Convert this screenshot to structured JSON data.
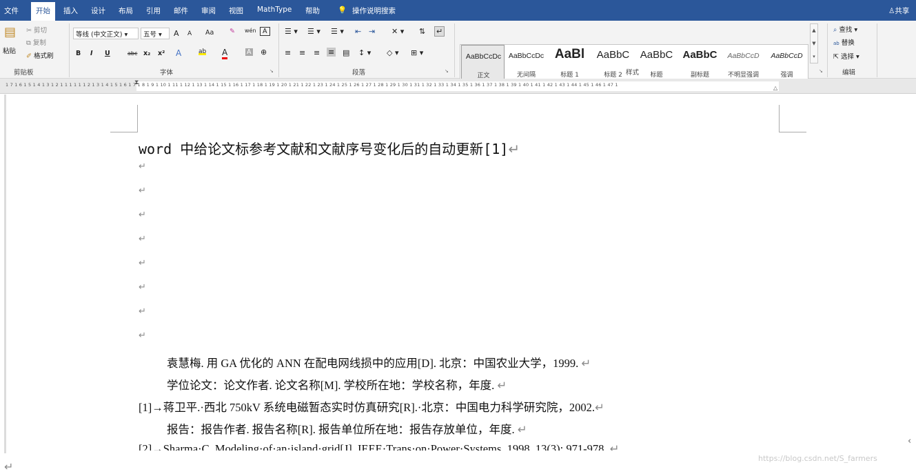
{
  "tabs": [
    "文件",
    "开始",
    "插入",
    "设计",
    "布局",
    "引用",
    "邮件",
    "审阅",
    "视图",
    "MathType",
    "帮助"
  ],
  "tell_me": "操作说明搜索",
  "share": "共享",
  "clipboard": {
    "paste": "粘贴",
    "cut": "剪切",
    "copy": "复制",
    "format_painter": "格式刷",
    "label": "剪贴板"
  },
  "font": {
    "name": "等线 (中文正文)",
    "size": "五号",
    "grow": "A",
    "shrink": "A",
    "case": "Aa",
    "phonetic": "wén",
    "border_char": "A",
    "bold": "B",
    "italic": "I",
    "underline": "U",
    "strike": "abc",
    "subscript": "x₂",
    "superscript": "x²",
    "effects": "A",
    "highlight": "ab",
    "color": "A",
    "shade": "A",
    "enclose": "⊕",
    "label": "字体"
  },
  "paragraph": {
    "label": "段落"
  },
  "styles": {
    "label": "样式",
    "items": [
      {
        "preview": "AaBbCcDc",
        "name": "正文"
      },
      {
        "preview": "AaBbCcDc",
        "name": "无间隔"
      },
      {
        "preview": "AaBl",
        "name": "标题 1"
      },
      {
        "preview": "AaBbC",
        "name": "标题 2"
      },
      {
        "preview": "AaBbC",
        "name": "标题"
      },
      {
        "preview": "AaBbC",
        "name": "副标题"
      },
      {
        "preview": "AaBbCcD",
        "name": "不明显强调"
      },
      {
        "preview": "AaBbCcD",
        "name": "强调"
      }
    ]
  },
  "editing": {
    "find": "查找",
    "replace": "替换",
    "select": "选择",
    "label": "编辑"
  },
  "ruler_text": "1 7 1 6 1 5 1 4 1 3 1 2 1 1 1  1 1 1 2 1 3 1 4 1 5 1 6 1 7 1 8 1 9 1 10 1 11 1 12 1 13 1 14 1 15 1 16 1 17 1 18 1 19 1 20 1 21 1 22 1 23 1 24 1 25 1 26 1 27 1 28 1 29 1 30 1 31 1 32 1 33 1 34 1 35 1 36 1 37 1 38 1 39 1 40 1 41 1 42 1 43 1 44 1 45 1 46 1 47 1",
  "document": {
    "title": "word 中给论文标参考文献和文献序号变化后的自动更新[1]",
    "mark": "↵",
    "lines": [
      "袁慧梅. 用 GA 优化的 ANN 在配电网线损中的应用[D]. 北京：中国农业大学，1999.",
      "学位论文：论文作者. 论文名称[M]. 学校所在地：学校名称，年度.",
      "[1]→蒋卫平.·西北 750kV 系统电磁暂态实时仿真研究[R].·北京：中国电力科学研究院，2002.",
      "报告：报告作者. 报告名称[R]. 报告单位所在地：报告存放单位，年度.",
      "[2]→Sharma·C. Modeling·of·an·island·grid[J]. IEEE·Trans·on·Power·Systems, 1998, 13(3): 971-978."
    ]
  },
  "watermark": "https://blog.csdn.net/S_farmers"
}
